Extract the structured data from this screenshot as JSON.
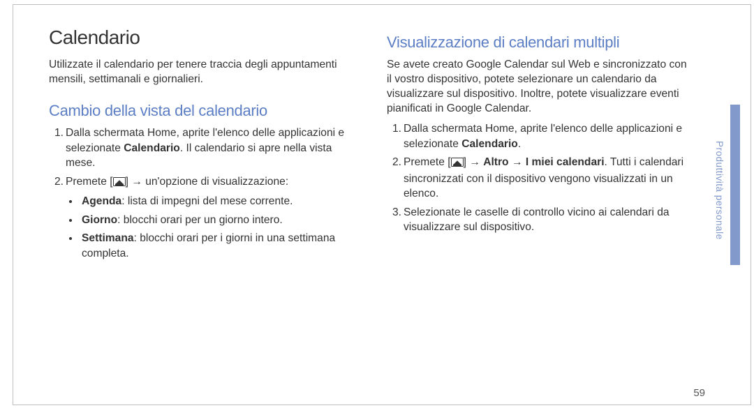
{
  "side_label": "Produttività personale",
  "page_number": "59",
  "left": {
    "main_heading": "Calendario",
    "intro": "Utilizzate il calendario per tenere traccia degli appuntamenti mensili, settimanali e giornalieri.",
    "sub_heading": "Cambio della vista del calendario",
    "steps": [
      {
        "num": "1.",
        "text_a": "Dalla schermata Home, aprite l'elenco delle applicazioni e selezionate ",
        "bold_a": "Calendario",
        "text_b": ". Il calendario si apre nella vista mese."
      },
      {
        "num": "2.",
        "text_a": "Premete [",
        "text_b": "] → un'opzione di visualizzazione:",
        "bullets": [
          {
            "bold": "Agenda",
            "text": ": lista di impegni del mese corrente."
          },
          {
            "bold": "Giorno",
            "text": ": blocchi orari per un giorno intero."
          },
          {
            "bold": "Settimana",
            "text": ": blocchi orari per i giorni in una settimana completa."
          }
        ]
      }
    ]
  },
  "right": {
    "sub_heading": "Visualizzazione di calendari multipli",
    "intro": "Se avete creato Google Calendar sul Web e sincronizzato con il vostro dispositivo, potete selezionare un calendario da visualizzare sul dispositivo. Inoltre, potete visualizzare eventi pianificati in Google Calendar.",
    "steps": [
      {
        "num": "1.",
        "text_a": "Dalla schermata Home, aprite l'elenco delle applicazioni e selezionate ",
        "bold_a": "Calendario",
        "text_b": "."
      },
      {
        "num": "2.",
        "text_a": "Premete [",
        "text_b": "] → ",
        "bold_b": "Altro",
        "text_c": " → ",
        "bold_c": "I miei calendari",
        "text_d": ". Tutti i calendari sincronizzati con il dispositivo vengono visualizzati in un elenco."
      },
      {
        "num": "3.",
        "text_a": "Selezionate le caselle di controllo vicino ai calendari da visualizzare sul dispositivo."
      }
    ]
  }
}
